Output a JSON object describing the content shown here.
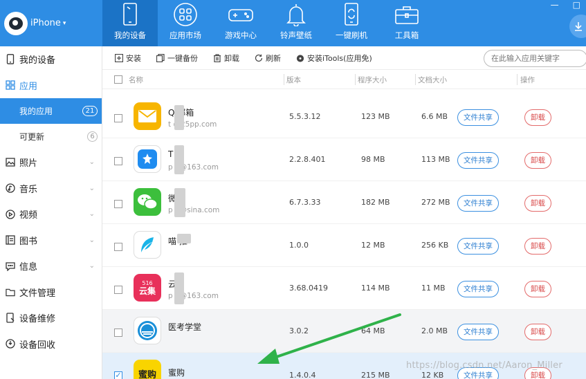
{
  "brand": {
    "name": "iPhone",
    "caret": "▾"
  },
  "nav": {
    "tabs": [
      {
        "label": "我的设备",
        "icon": "phone-icon",
        "active": true
      },
      {
        "label": "应用市场",
        "icon": "app-grid-icon",
        "active": false
      },
      {
        "label": "游戏中心",
        "icon": "gamepad-icon",
        "active": false
      },
      {
        "label": "铃声壁纸",
        "icon": "bell-icon",
        "active": false
      },
      {
        "label": "一键刷机",
        "icon": "refresh-phone-icon",
        "active": false
      },
      {
        "label": "工具箱",
        "icon": "toolbox-icon",
        "active": false
      }
    ],
    "window_controls": [
      "—",
      "□"
    ]
  },
  "sidebar": {
    "items": [
      {
        "label": "我的设备",
        "icon": "device-icon"
      },
      {
        "label": "应用",
        "icon": "apps-icon"
      },
      {
        "label": "我的应用",
        "count": "21"
      },
      {
        "label": "可更新",
        "count": "6"
      },
      {
        "label": "照片",
        "icon": "photo-icon"
      },
      {
        "label": "音乐",
        "icon": "music-icon"
      },
      {
        "label": "视频",
        "icon": "video-icon"
      },
      {
        "label": "图书",
        "icon": "book-icon"
      },
      {
        "label": "信息",
        "icon": "message-icon"
      },
      {
        "label": "文件管理",
        "icon": "folder-icon"
      },
      {
        "label": "设备维修",
        "icon": "repair-icon"
      },
      {
        "label": "设备回收",
        "icon": "recycle-icon"
      }
    ]
  },
  "toolbar": {
    "install": "安装",
    "backup": "一键备份",
    "uninstall": "卸载",
    "refresh": "刷新",
    "install_itools": "安装iTools(应用免)",
    "search_placeholder": "在此输入应用关键字"
  },
  "table": {
    "headers": {
      "name": "名称",
      "version": "版本",
      "program_size": "程序大小",
      "doc_size": "文档大小",
      "action": "操作"
    },
    "share_label": "文件共享",
    "uninstall_label": "卸载",
    "rows": [
      {
        "name": "Q  邮箱",
        "account": "t     @25pp.com",
        "version": "5.5.3.12",
        "program_size": "123 MB",
        "doc_size": "6.6 MB",
        "icon": "mail-app-icon",
        "icon_color": "#f7b500",
        "state": "normal"
      },
      {
        "name": "T",
        "account": "p     n@163.com",
        "version": "2.2.8.401",
        "program_size": "98 MB",
        "doc_size": "113 MB",
        "icon": "dingtalk-app-icon",
        "icon_color": "#1f8cf0",
        "state": "normal"
      },
      {
        "name": "微",
        "account": "p     n@sina.com",
        "version": "6.7.3.33",
        "program_size": "182 MB",
        "doc_size": "272 MB",
        "icon": "wechat-app-icon",
        "icon_color": "#3cbf3c",
        "state": "normal"
      },
      {
        "name": "喵    推",
        "account": "",
        "version": "1.0.0",
        "program_size": "12 MB",
        "doc_size": "256 KB",
        "icon": "feather-app-icon",
        "icon_color": "#19b4e8",
        "state": "normal"
      },
      {
        "name": "云",
        "account": "p     n@163.com",
        "version": "3.68.0419",
        "program_size": "114 MB",
        "doc_size": "11 MB",
        "icon": "yunji-app-icon",
        "icon_color": "#e8305a",
        "icon_text": "云集",
        "icon_sub": "516",
        "state": "normal"
      },
      {
        "name": "医考学堂",
        "account": "",
        "version": "3.0.2",
        "program_size": "64 MB",
        "doc_size": "2.0 MB",
        "icon": "yikao-app-icon",
        "icon_color": "#1a8fd8",
        "state": "hover"
      },
      {
        "name": "蜜购",
        "account": "",
        "version": "1.4.0.4",
        "program_size": "215 MB",
        "doc_size": "12 KB",
        "icon": "migou-app-icon",
        "icon_color": "#f9d400",
        "icon_text": "蜜购",
        "state": "selected"
      }
    ]
  },
  "watermark": "https://blog.csdn.net/Aaron_Miller",
  "colors": {
    "primary": "#2e8de4",
    "nav_active": "#1b73c6",
    "danger": "#d84848",
    "annotation_arrow": "#2fb24a"
  }
}
